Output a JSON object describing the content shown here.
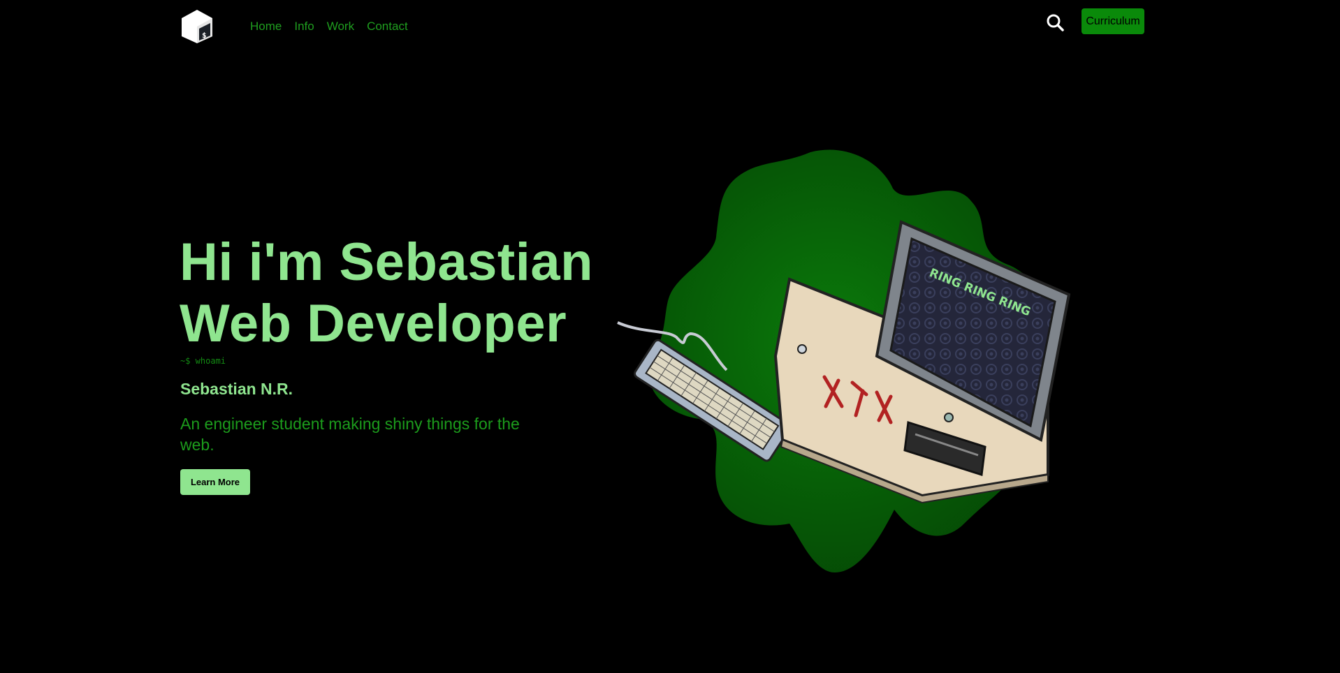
{
  "nav": {
    "logo_icon": "terminal-cube-icon",
    "links": [
      "Home",
      "Info",
      "Work",
      "Contact"
    ],
    "search_icon": "search-icon",
    "cv_label": "Curriculum"
  },
  "hero": {
    "title_line1": "Hi i'm Sebastian",
    "title_line2": "Web Developer",
    "prompt": "~$ whoami",
    "name": "Sebastian N.R.",
    "tagline": "An engineer student making shiny things for the web.",
    "cta_label": "Learn More",
    "screen_text": "RING RING RING"
  },
  "colors": {
    "background": "#000000",
    "accent_light": "#8fe58f",
    "accent_dark": "#0a8a0a",
    "nav_link": "#1f9e1f"
  }
}
